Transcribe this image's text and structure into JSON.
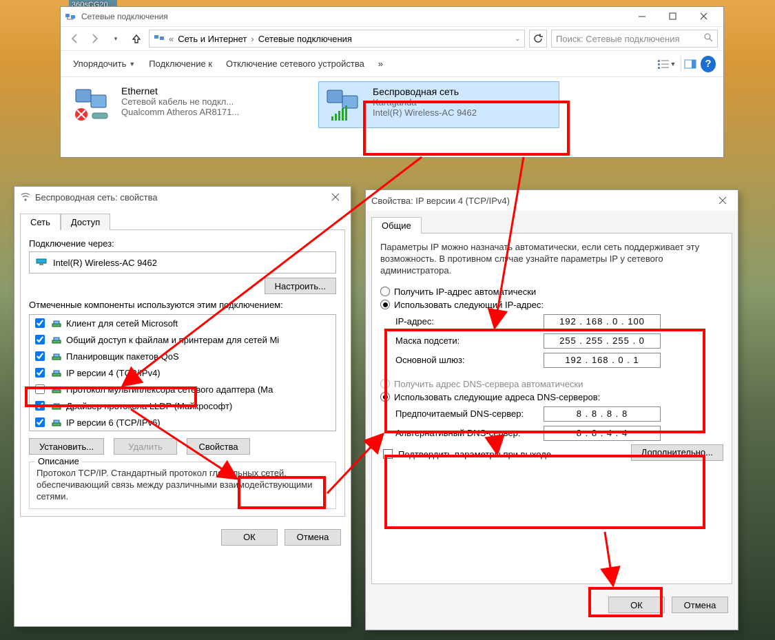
{
  "desktop": {
    "icon_label": "360sCG20..."
  },
  "explorer": {
    "title": "Сетевые подключения",
    "breadcrumb": {
      "prefix": "«",
      "part1": "Сеть и Интернет",
      "part2": "Сетевые подключения"
    },
    "search_placeholder": "Поиск: Сетевые подключения",
    "commands": {
      "organize": "Упорядочить",
      "connect": "Подключение к",
      "disable": "Отключение сетевого устройства",
      "overflow": "»"
    },
    "items": {
      "eth": {
        "name": "Ethernet",
        "status": "Сетевой кабель не подкл...",
        "driver": "Qualcomm Atheros AR8171..."
      },
      "wifi": {
        "name": "Беспроводная сеть",
        "ssid": "Karaganda",
        "driver": "Intel(R) Wireless-AC 9462"
      }
    }
  },
  "dlg1": {
    "title": "Беспроводная сеть: свойства",
    "tabs": {
      "net": "Сеть",
      "access": "Доступ"
    },
    "connect_via_label": "Подключение через:",
    "adapter": "Intel(R) Wireless-AC 9462",
    "configure_btn": "Настроить...",
    "components_label": "Отмеченные компоненты используются этим подключением:",
    "components": [
      {
        "checked": true,
        "label": "Клиент для сетей Microsoft"
      },
      {
        "checked": true,
        "label": "Общий доступ к файлам и принтерам для сетей Mi"
      },
      {
        "checked": true,
        "label": "Планировщик пакетов QoS"
      },
      {
        "checked": true,
        "label": "IP версии 4 (TCP/IPv4)"
      },
      {
        "checked": false,
        "label": "Протокол мультиплексора сетевого адаптера (Ма"
      },
      {
        "checked": true,
        "label": "Драйвер протокола LLDP (Майкрософт)"
      },
      {
        "checked": true,
        "label": "IP версии 6 (TCP/IPv6)"
      }
    ],
    "install_btn": "Установить...",
    "remove_btn": "Удалить",
    "props_btn": "Свойства",
    "desc_title": "Описание",
    "desc_text": "Протокол TCP/IP. Стандартный протокол глобальных сетей, обеспечивающий связь между различными взаимодействующими сетями.",
    "ok": "ОК",
    "cancel": "Отмена"
  },
  "dlg2": {
    "title": "Свойства: IP версии 4 (TCP/IPv4)",
    "tab_general": "Общие",
    "intro": "Параметры IP можно назначать автоматически, если сеть поддерживает эту возможность. В противном случае узнайте параметры IP у сетевого администратора.",
    "ip_auto": "Получить IP-адрес автоматически",
    "ip_manual": "Использовать следующий IP-адрес:",
    "ip_label": "IP-адрес:",
    "mask_label": "Маска подсети:",
    "gw_label": "Основной шлюз:",
    "ip_value": "192 . 168 .  0  . 100",
    "mask_value": "255 . 255 . 255 .  0",
    "gw_value": "192 . 168 .  0  .  1",
    "dns_auto": "Получить адрес DNS-сервера автоматически",
    "dns_manual": "Использовать следующие адреса DNS-серверов:",
    "dns1_label": "Предпочитаемый DNS-сервер:",
    "dns2_label": "Альтернативный DNS-сервер:",
    "dns1_value": "8  .  8  .  8  .  8",
    "dns2_value": "8  .  8  .  4  .  4",
    "confirm_label": "Подтвердить параметры при выходе",
    "advanced_btn": "Дополнительно...",
    "ok": "ОК",
    "cancel": "Отмена"
  }
}
